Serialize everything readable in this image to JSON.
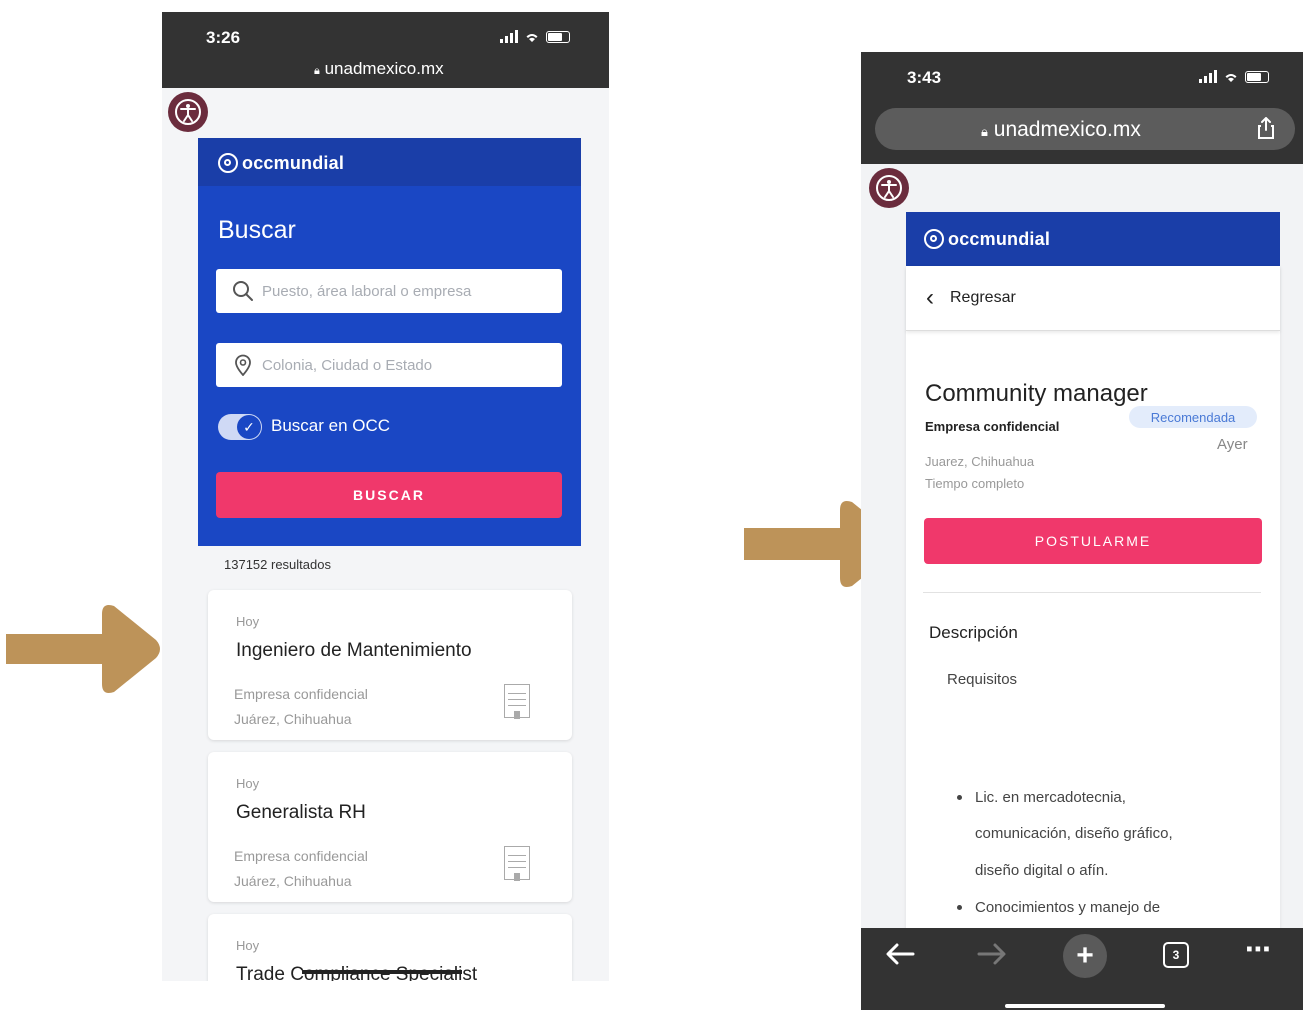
{
  "colors": {
    "arrow": "#bd9359",
    "occ_blue": "#1a47c4",
    "occ_header_blue": "#1a3ea8",
    "pink_button": "#f0386b",
    "badge_bg": "#e3ecfb",
    "badge_text": "#4a7ad6",
    "accessibility_icon": "#6b2c3d"
  },
  "phone_left": {
    "status_time": "3:26",
    "url": "unadmexico.mx",
    "logo": "occmundial",
    "search_title": "Buscar",
    "search_placeholder": "Puesto, área laboral o empresa",
    "location_placeholder": "Colonia, Ciudad o Estado",
    "toggle_label": "Buscar en OCC",
    "toggle_on": true,
    "search_button": "BUSCAR",
    "results_count": "137152 resultados",
    "jobs": [
      {
        "date": "Hoy",
        "title": "Ingeniero de Mantenimiento",
        "company": "Empresa confidencial",
        "location": "Juárez, Chihuahua"
      },
      {
        "date": "Hoy",
        "title": "Generalista RH",
        "company": "Empresa confidencial",
        "location": "Juárez, Chihuahua"
      },
      {
        "date": "Hoy",
        "title": "Trade Compliance Specialist"
      }
    ]
  },
  "phone_right": {
    "status_time": "3:43",
    "url": "unadmexico.mx",
    "logo": "occmundial",
    "back_label": "Regresar",
    "job_title": "Community manager",
    "badge": "Recomendada",
    "company": "Empresa confidencial",
    "posted": "Ayer",
    "location": "Juarez, Chihuahua",
    "job_type": "Tiempo completo",
    "apply_button": "POSTULARME",
    "description_title": "Descripción",
    "requirements_label": "Requisitos",
    "bullets": [
      {
        "lines": [
          "Lic. en mercadotecnia,",
          "comunicación, diseño gráfico,",
          "diseño digital o afín."
        ]
      },
      {
        "lines": [
          "Conocimientos y manejo de"
        ]
      }
    ],
    "tab_count": "3"
  }
}
